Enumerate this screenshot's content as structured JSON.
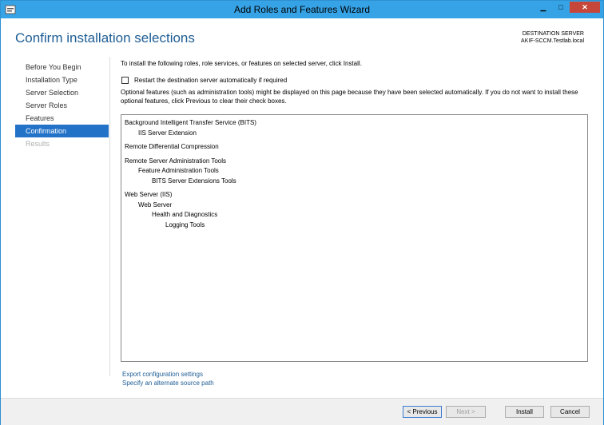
{
  "window": {
    "title": "Add Roles and Features Wizard",
    "minimize": "▁",
    "maximize": "□",
    "close": "✕"
  },
  "header": {
    "title": "Confirm installation selections",
    "dest_label": "DESTINATION SERVER",
    "dest_server": "AKIF-SCCM.Testlab.local"
  },
  "nav": {
    "items": [
      {
        "label": "Before You Begin"
      },
      {
        "label": "Installation Type"
      },
      {
        "label": "Server Selection"
      },
      {
        "label": "Server Roles"
      },
      {
        "label": "Features"
      },
      {
        "label": "Confirmation"
      },
      {
        "label": "Results"
      }
    ]
  },
  "main": {
    "intro": "To install the following roles, role services, or features on selected server, click Install.",
    "restart_checkbox": "Restart the destination server automatically if required",
    "note": "Optional features (such as administration tools) might be displayed on this page because they have been selected automatically. If you do not want to install these optional features, click Previous to clear their check boxes.",
    "features": [
      {
        "label": "Background Intelligent Transfer Service (BITS)"
      },
      {
        "label": "IIS Server Extension"
      },
      {
        "label": "Remote Differential Compression"
      },
      {
        "label": "Remote Server Administration Tools"
      },
      {
        "label": "Feature Administration Tools"
      },
      {
        "label": "BITS Server Extensions Tools"
      },
      {
        "label": "Web Server (IIS)"
      },
      {
        "label": "Web Server"
      },
      {
        "label": "Health and Diagnostics"
      },
      {
        "label": "Logging Tools"
      }
    ],
    "links": {
      "export": "Export configuration settings",
      "alt_source": "Specify an alternate source path"
    }
  },
  "footer": {
    "previous": "< Previous",
    "next": "Next >",
    "install": "Install",
    "cancel": "Cancel"
  },
  "colors": {
    "titlebar": "#36a3e6",
    "accent": "#2272c8",
    "header_text": "#1e5d94",
    "close_button": "#c7463a"
  }
}
